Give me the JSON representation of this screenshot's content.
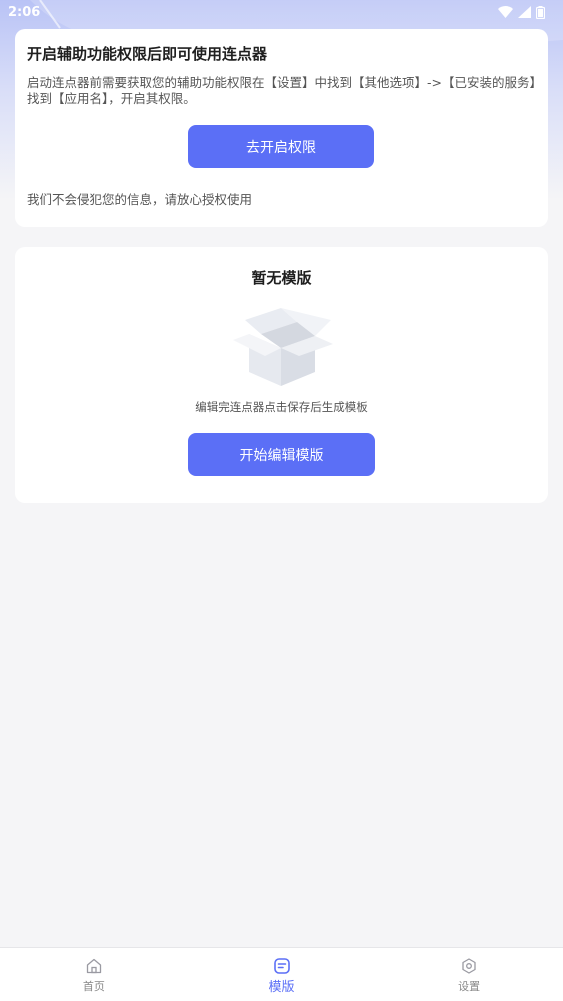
{
  "status_bar": {
    "time": "2:06"
  },
  "permission_card": {
    "title": "开启辅助功能权限后即可使用连点器",
    "description": "启动连点器前需要获取您的辅助功能权限在【设置】中找到【其他选项】->【已安装的服务】找到【应用名】，开启其权限。",
    "button_label": "去开启权限",
    "note": "我们不会侵犯您的信息，请放心授权使用"
  },
  "template_card": {
    "title": "暂无模版",
    "empty_hint": "编辑完连点器点击保存后生成模板",
    "button_label": "开始编辑模版"
  },
  "tabbar": {
    "tabs": [
      {
        "label": "首页",
        "icon": "home-icon",
        "active": false
      },
      {
        "label": "模版",
        "icon": "template-icon",
        "active": true
      },
      {
        "label": "设置",
        "icon": "settings-icon",
        "active": false
      }
    ]
  },
  "colors": {
    "accent": "#5b6ff6",
    "background": "#f5f5f7",
    "card": "#ffffff",
    "header_gradient": "#b9c3f6"
  }
}
